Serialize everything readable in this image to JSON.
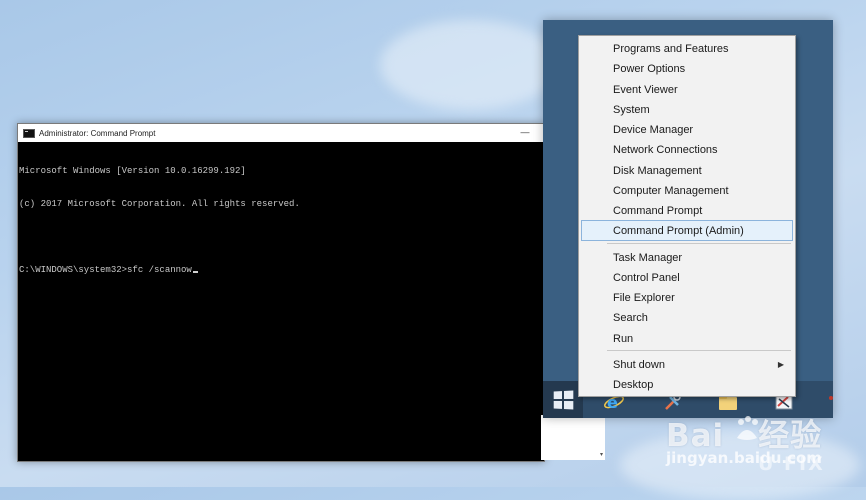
{
  "cmd": {
    "title": "Administrator: Command Prompt",
    "minimize_symbol": "—",
    "lines": [
      "Microsoft Windows [Version 10.0.16299.192]",
      "(c) 2017 Microsoft Corporation. All rights reserved.",
      "",
      "C:\\WINDOWS\\system32>sfc /scannow"
    ]
  },
  "context_menu": {
    "groups": [
      [
        {
          "label": "Programs and Features"
        },
        {
          "label": "Power Options"
        },
        {
          "label": "Event Viewer"
        },
        {
          "label": "System"
        },
        {
          "label": "Device Manager"
        },
        {
          "label": "Network Connections"
        },
        {
          "label": "Disk Management"
        },
        {
          "label": "Computer Management"
        },
        {
          "label": "Command Prompt"
        },
        {
          "label": "Command Prompt (Admin)",
          "highlighted": true
        }
      ],
      [
        {
          "label": "Task Manager"
        },
        {
          "label": "Control Panel"
        },
        {
          "label": "File Explorer"
        },
        {
          "label": "Search"
        },
        {
          "label": "Run"
        }
      ],
      [
        {
          "label": "Shut down",
          "submenu": true
        },
        {
          "label": "Desktop"
        }
      ]
    ],
    "submenu_arrow": "▶"
  },
  "taskbar": {
    "icons": [
      "windows-logo-icon",
      "internet-explorer-icon",
      "tools-icon",
      "file-explorer-icon",
      "paint-icon"
    ]
  },
  "watermark": {
    "baidu": "Bai",
    "baidu_cn": "经验",
    "url": "jingyan.baidu.com",
    "ugetfix": "U    FIX"
  },
  "colors": {
    "desktop": "#b9d3ee",
    "start_panel": "#3a5f82",
    "menu_bg": "#f2f2f2",
    "highlight": "#e5f1fb",
    "highlight_border": "#8cb4dc"
  }
}
